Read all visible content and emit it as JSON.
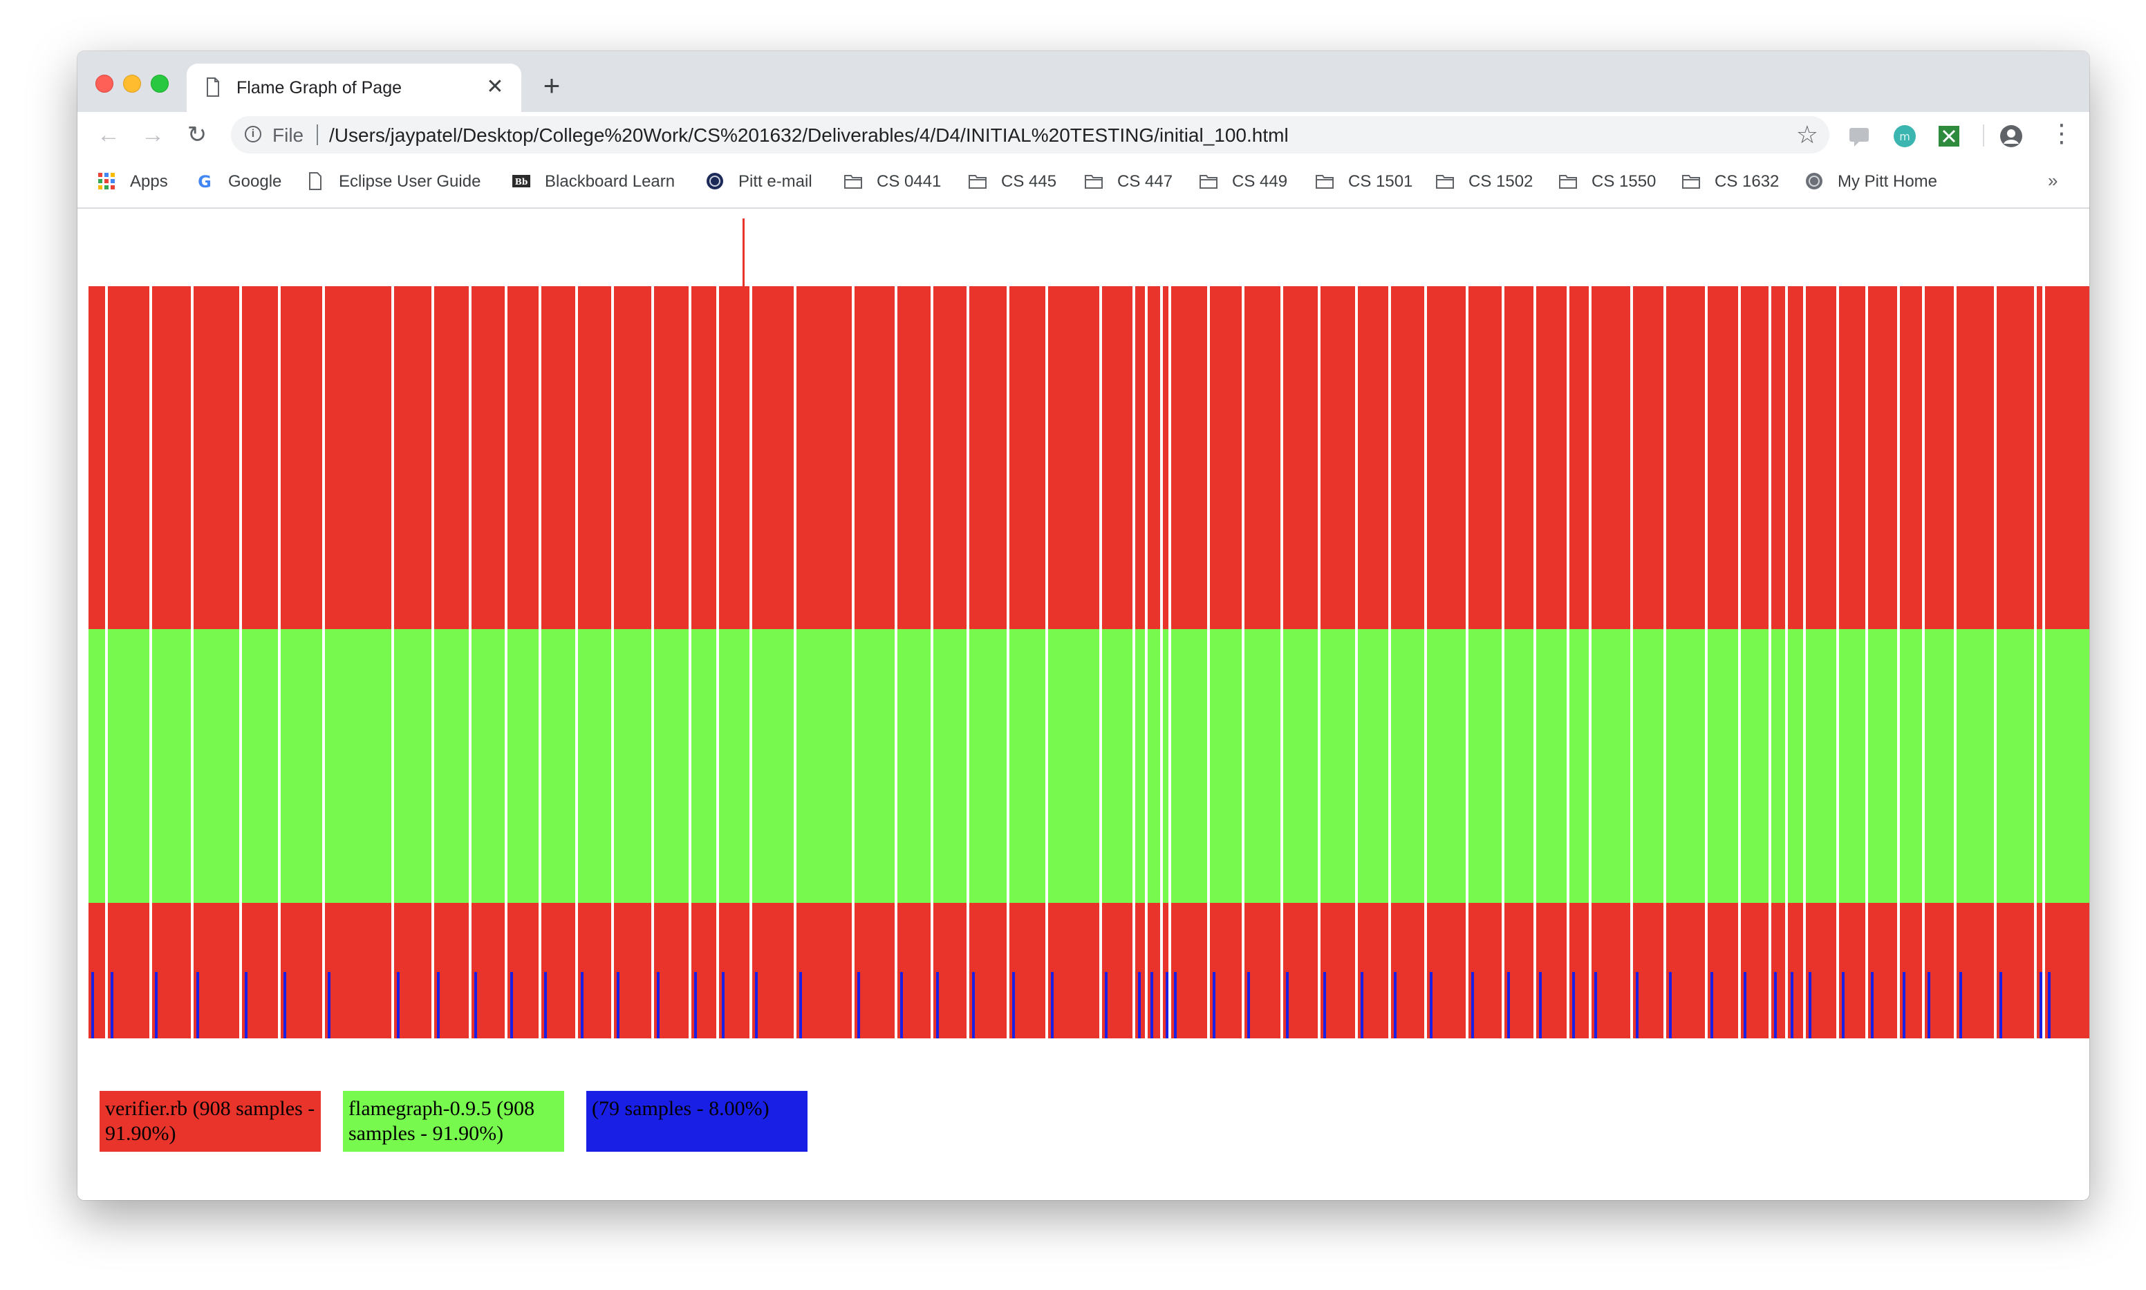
{
  "browser": {
    "tab_title": "Flame Graph of Page",
    "tab_close_glyph": "✕",
    "new_tab_glyph": "+",
    "scheme_label": "File",
    "url": "/Users/jaypatel/Desktop/College%20Work/CS%201632/Deliverables/4/D4/INITIAL%20TESTING/initial_100.html",
    "back_glyph": "←",
    "forward_glyph": "→",
    "reload_glyph": "↻",
    "star_glyph": "☆",
    "menu_glyph": "⋮",
    "bookmarks_more_glyph": "»"
  },
  "bookmarks": [
    {
      "label": "Apps",
      "icon": "apps-grid-icon"
    },
    {
      "label": "Google",
      "icon": "google-icon"
    },
    {
      "label": "Eclipse User Guide",
      "icon": "page-icon"
    },
    {
      "label": "Blackboard Learn",
      "icon": "blackboard-icon"
    },
    {
      "label": "Pitt e-mail",
      "icon": "pitt-seal-icon"
    },
    {
      "label": "CS 0441",
      "icon": "folder-icon"
    },
    {
      "label": "CS 445",
      "icon": "folder-icon"
    },
    {
      "label": "CS 447",
      "icon": "folder-icon"
    },
    {
      "label": "CS 449",
      "icon": "folder-icon"
    },
    {
      "label": "CS 1501",
      "icon": "folder-icon"
    },
    {
      "label": "CS 1502",
      "icon": "folder-icon"
    },
    {
      "label": "CS 1550",
      "icon": "folder-icon"
    },
    {
      "label": "CS 1632",
      "icon": "folder-icon"
    },
    {
      "label": "My Pitt Home",
      "icon": "pitt-seal-icon"
    }
  ],
  "colors": {
    "red": "#e8342a",
    "green": "#77f94d",
    "blue": "#1a1fe6"
  },
  "flamegraph": {
    "legend": [
      {
        "text": "verifier.rb (908 samples - 91.90%)",
        "color": "#e8342a"
      },
      {
        "text": "flamegraph-0.9.5 (908 samples - 91.90%)",
        "color": "#77f94d"
      },
      {
        "text": "(79 samples - 8.00%)",
        "color": "#1a1fe6"
      }
    ]
  }
}
